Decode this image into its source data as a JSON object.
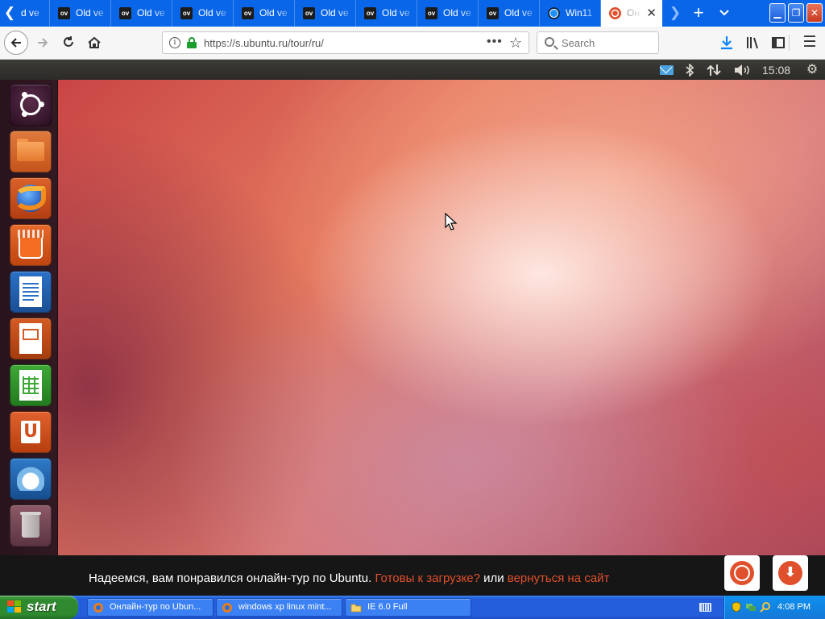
{
  "browser": {
    "tabs": [
      {
        "favicon": "ov",
        "title": "d ve"
      },
      {
        "favicon": "ov",
        "title": "Old ve"
      },
      {
        "favicon": "ov",
        "title": "Old ve"
      },
      {
        "favicon": "ov",
        "title": "Old ve"
      },
      {
        "favicon": "ov",
        "title": "Old ve"
      },
      {
        "favicon": "ov",
        "title": "Old ve"
      },
      {
        "favicon": "ov",
        "title": "Old ve"
      },
      {
        "favicon": "ov",
        "title": "Old ve"
      },
      {
        "favicon": "ov",
        "title": "Old ve"
      },
      {
        "favicon": "web-icon",
        "title": "Win11"
      },
      {
        "favicon": "ubuntu-icon",
        "title": "Он",
        "active": true
      }
    ],
    "url": "https://s.ubuntu.ru/tour/ru/",
    "search_placeholder": "Search"
  },
  "ubuntu": {
    "panel": {
      "time": "15:08"
    },
    "launcher": [
      "dash-home",
      "files",
      "firefox",
      "software-center",
      "writer",
      "impress",
      "calc",
      "ubuntu-one",
      "thunderbird",
      "trash"
    ]
  },
  "tour": {
    "message": "Надеемся, вам понравился онлайн-тур по Ubuntu. ",
    "link_download": "Готовы к загрузке?",
    "connector": " или ",
    "link_back": "вернуться на сайт"
  },
  "xp": {
    "start_label": "start",
    "tasks": [
      {
        "label": "Онлайн-тур по Ubun..."
      },
      {
        "label": "windows xp linux mint..."
      },
      {
        "label": "IE 6.0 Full"
      }
    ],
    "clock": "4:08 PM"
  },
  "colors": {
    "tab_blue": "#0a66e8",
    "ubuntu_orange": "#e0502c",
    "xp_blue": "#245edb",
    "start_green": "#2f8a2f"
  }
}
